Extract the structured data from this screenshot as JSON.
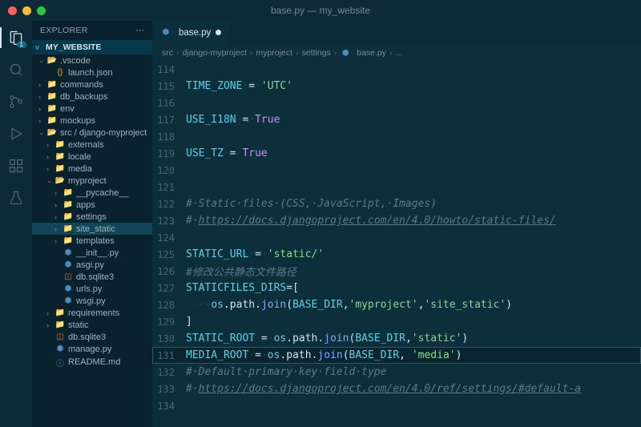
{
  "window": {
    "title": "base.py — my_website"
  },
  "activity": {
    "badge": "1"
  },
  "sidebar": {
    "title": "EXPLORER",
    "root": "MY_WEBSITE",
    "tree": [
      {
        "label": ".vscode",
        "type": "folder-open",
        "indent": 0,
        "chev": "v"
      },
      {
        "label": "launch.json",
        "type": "json",
        "indent": 1
      },
      {
        "label": "commands",
        "type": "folder",
        "indent": 0,
        "chev": ">"
      },
      {
        "label": "db_backups",
        "type": "folder",
        "indent": 0,
        "chev": ">"
      },
      {
        "label": "env",
        "type": "folder",
        "indent": 0,
        "chev": ">"
      },
      {
        "label": "mockups",
        "type": "folder",
        "indent": 0,
        "chev": ">"
      },
      {
        "label": "src / django-myproject",
        "type": "folder-open",
        "indent": 0,
        "chev": "v"
      },
      {
        "label": "externals",
        "type": "folder",
        "indent": 1,
        "chev": ">"
      },
      {
        "label": "locale",
        "type": "folder",
        "indent": 1,
        "chev": ">"
      },
      {
        "label": "media",
        "type": "folder",
        "indent": 1,
        "chev": ">"
      },
      {
        "label": "myproject",
        "type": "folder-open",
        "indent": 1,
        "chev": "v"
      },
      {
        "label": "__pycache__",
        "type": "folder",
        "indent": 2,
        "chev": ">"
      },
      {
        "label": "apps",
        "type": "folder",
        "indent": 2,
        "chev": ">"
      },
      {
        "label": "settings",
        "type": "folder",
        "indent": 2,
        "chev": ">"
      },
      {
        "label": "site_static",
        "type": "folder",
        "indent": 2,
        "chev": ">",
        "selected": true
      },
      {
        "label": "templates",
        "type": "folder",
        "indent": 2,
        "chev": ">"
      },
      {
        "label": "__init__.py",
        "type": "py",
        "indent": 2
      },
      {
        "label": "asgi.py",
        "type": "py",
        "indent": 2
      },
      {
        "label": "db.sqlite3",
        "type": "db",
        "indent": 2
      },
      {
        "label": "urls.py",
        "type": "py",
        "indent": 2
      },
      {
        "label": "wsgi.py",
        "type": "py",
        "indent": 2
      },
      {
        "label": "requirements",
        "type": "folder",
        "indent": 1,
        "chev": ">"
      },
      {
        "label": "static",
        "type": "folder",
        "indent": 1,
        "chev": ">"
      },
      {
        "label": "db.sqlite3",
        "type": "db",
        "indent": 1
      },
      {
        "label": "manage.py",
        "type": "py",
        "indent": 1
      },
      {
        "label": "README.md",
        "type": "md",
        "indent": 1
      }
    ]
  },
  "tab": {
    "name": "base.py",
    "icon": "py",
    "dirty": true
  },
  "breadcrumbs": [
    "src",
    "django-myproject",
    "myproject",
    "settings",
    "base.py",
    "..."
  ],
  "code": [
    {
      "n": 114,
      "t": []
    },
    {
      "n": 115,
      "t": [
        [
          "var",
          "TIME_ZONE"
        ],
        [
          "ws",
          "·"
        ],
        [
          "op",
          "="
        ],
        [
          "ws",
          "·"
        ],
        [
          "str",
          "'UTC'"
        ]
      ]
    },
    {
      "n": 116,
      "t": []
    },
    {
      "n": 117,
      "t": [
        [
          "var",
          "USE_I18N"
        ],
        [
          "ws",
          "·"
        ],
        [
          "op",
          "="
        ],
        [
          "ws",
          "·"
        ],
        [
          "bool",
          "True"
        ]
      ]
    },
    {
      "n": 118,
      "t": []
    },
    {
      "n": 119,
      "t": [
        [
          "var",
          "USE_TZ"
        ],
        [
          "ws",
          "·"
        ],
        [
          "op",
          "="
        ],
        [
          "ws",
          "·"
        ],
        [
          "bool",
          "True"
        ]
      ]
    },
    {
      "n": 120,
      "t": []
    },
    {
      "n": 121,
      "t": []
    },
    {
      "n": 122,
      "t": [
        [
          "com",
          "#·Static·files·(CSS,·JavaScript,·Images)"
        ]
      ]
    },
    {
      "n": 123,
      "t": [
        [
          "com",
          "#·"
        ],
        [
          "link",
          "https://docs.djangoproject.com/en/4.0/howto/static-files/"
        ]
      ]
    },
    {
      "n": 124,
      "t": []
    },
    {
      "n": 125,
      "t": [
        [
          "var",
          "STATIC_URL"
        ],
        [
          "ws",
          "·"
        ],
        [
          "op",
          "="
        ],
        [
          "ws",
          "·"
        ],
        [
          "str",
          "'static/'"
        ]
      ]
    },
    {
      "n": 126,
      "t": [
        [
          "com",
          "#修改公共静态文件路径"
        ]
      ]
    },
    {
      "n": 127,
      "t": [
        [
          "var",
          "STATICFILES_DIRS"
        ],
        [
          "op",
          "="
        ],
        [
          "pun",
          "["
        ]
      ]
    },
    {
      "n": 128,
      "t": [
        [
          "ws",
          "····"
        ],
        [
          "mod",
          "os"
        ],
        [
          "pun",
          "."
        ],
        [
          "id",
          "path"
        ],
        [
          "pun",
          "."
        ],
        [
          "fn",
          "join"
        ],
        [
          "pun",
          "("
        ],
        [
          "var",
          "BASE_DIR"
        ],
        [
          "pun",
          ","
        ],
        [
          "str",
          "'myproject'"
        ],
        [
          "pun",
          ","
        ],
        [
          "str",
          "'site_static'"
        ],
        [
          "pun",
          ")"
        ]
      ]
    },
    {
      "n": 129,
      "t": [
        [
          "pun",
          "]"
        ]
      ]
    },
    {
      "n": 130,
      "t": [
        [
          "var",
          "STATIC_ROOT"
        ],
        [
          "ws",
          "·"
        ],
        [
          "op",
          "="
        ],
        [
          "ws",
          "·"
        ],
        [
          "mod",
          "os"
        ],
        [
          "pun",
          "."
        ],
        [
          "id",
          "path"
        ],
        [
          "pun",
          "."
        ],
        [
          "fn",
          "join"
        ],
        [
          "pun",
          "("
        ],
        [
          "var",
          "BASE_DIR"
        ],
        [
          "pun",
          ","
        ],
        [
          "str",
          "'static'"
        ],
        [
          "pun",
          ")"
        ]
      ]
    },
    {
      "n": 131,
      "hl": true,
      "t": [
        [
          "var",
          "MEDIA_ROOT"
        ],
        [
          "ws",
          "·"
        ],
        [
          "op",
          "="
        ],
        [
          "ws",
          "·"
        ],
        [
          "mod",
          "os"
        ],
        [
          "pun",
          "."
        ],
        [
          "id",
          "path"
        ],
        [
          "pun",
          "."
        ],
        [
          "fn",
          "join"
        ],
        [
          "pun",
          "("
        ],
        [
          "var",
          "BASE_DIR"
        ],
        [
          "pun",
          ","
        ],
        [
          "ws",
          "·"
        ],
        [
          "str",
          "'media'"
        ],
        [
          "pun",
          ")"
        ]
      ]
    },
    {
      "n": 132,
      "t": [
        [
          "com",
          "#·Default·primary·key·field·type"
        ]
      ]
    },
    {
      "n": 133,
      "t": [
        [
          "com",
          "#·"
        ],
        [
          "link",
          "https://docs.djangoproject.com/en/4.0/ref/settings/#default-a"
        ]
      ]
    },
    {
      "n": 134,
      "t": []
    }
  ]
}
